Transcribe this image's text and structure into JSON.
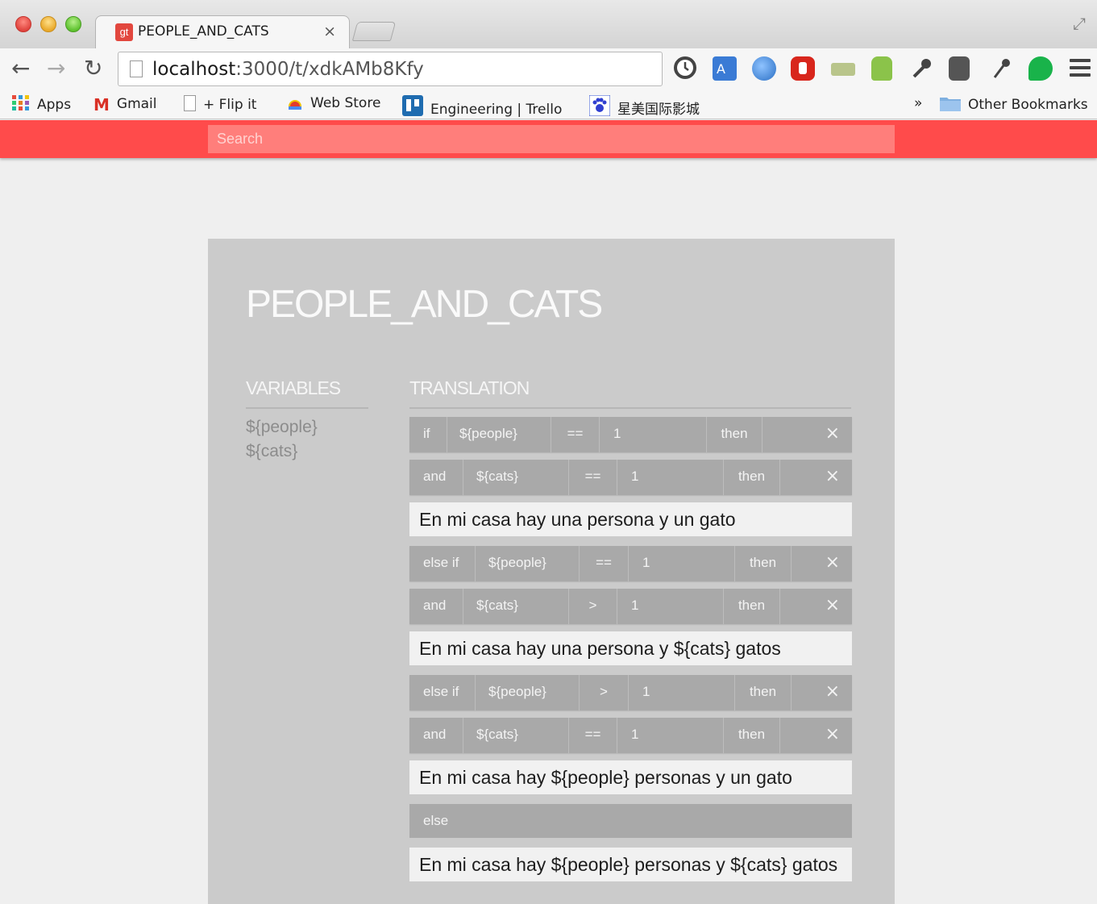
{
  "browser": {
    "tab_favicon": "gt",
    "tab_title": "PEOPLE_AND_CATS",
    "tab_close": "×",
    "url_host": "localhost",
    "url_rest": ":3000/t/xdkAMb8Kfy",
    "bookmarks": [
      {
        "label": "Apps",
        "icon": "apps-grid-icon"
      },
      {
        "label": "Gmail",
        "icon": "gmail-icon"
      },
      {
        "label": "+ Flip it",
        "icon": "page-icon"
      },
      {
        "label": "Web Store",
        "icon": "webstore-icon"
      },
      {
        "label": "Engineering | Trello",
        "icon": "trello-icon"
      },
      {
        "label": "星美国际影城",
        "icon": "baidu-paw-icon"
      }
    ],
    "overflow": "»",
    "other_bookmarks": "Other Bookmarks"
  },
  "search": {
    "placeholder": "Search"
  },
  "project": {
    "title": "PEOPLE_AND_CATS"
  },
  "variables": {
    "heading": "VARIABLES",
    "items": [
      "${people}",
      "${cats}"
    ]
  },
  "translation": {
    "heading": "TRANSLATION",
    "blocks": [
      {
        "conditions": [
          {
            "keyword": "if",
            "variable": "${people}",
            "operator": "==",
            "value": "1",
            "then": "then"
          },
          {
            "keyword": "and",
            "variable": "${cats}",
            "operator": "==",
            "value": "1",
            "then": "then"
          }
        ],
        "text": "En mi casa hay una persona y un gato"
      },
      {
        "conditions": [
          {
            "keyword": "else if",
            "variable": "${people}",
            "operator": "==",
            "value": "1",
            "then": "then"
          },
          {
            "keyword": "and",
            "variable": "${cats}",
            "operator": ">",
            "value": "1",
            "then": "then"
          }
        ],
        "text": "En mi casa hay una persona y ${cats} gatos"
      },
      {
        "conditions": [
          {
            "keyword": "else if",
            "variable": "${people}",
            "operator": ">",
            "value": "1",
            "then": "then"
          },
          {
            "keyword": "and",
            "variable": "${cats}",
            "operator": "==",
            "value": "1",
            "then": "then"
          }
        ],
        "text": "En mi casa hay ${people} personas y un gato"
      }
    ],
    "else_label": "else",
    "else_text": "En mi casa hay ${people} personas y ${cats} gatos",
    "remove_glyph": "×"
  }
}
